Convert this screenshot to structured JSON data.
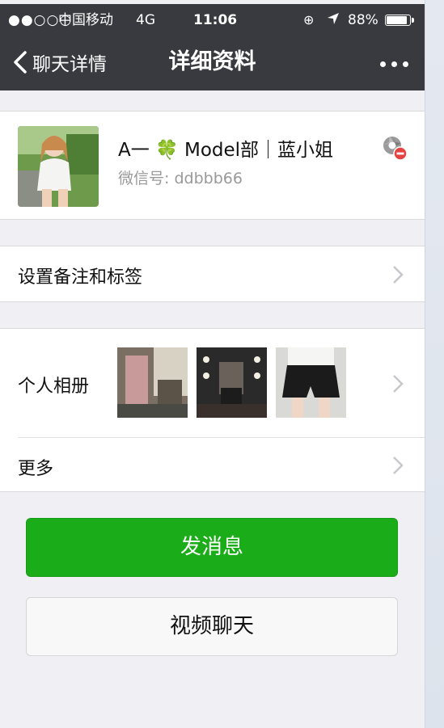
{
  "status_bar": {
    "signal": "●●○○○",
    "carrier": "中国移动",
    "network": "4G",
    "time": "11:06",
    "lock_icon": "⊕",
    "location_icon": "➤",
    "battery": "88%",
    "battery_level": 0.88
  },
  "nav": {
    "back_label": "聊天详情",
    "title": "详细资料",
    "more_icon": "more-dots-icon"
  },
  "profile": {
    "nickname": "A一 🍀 Model部｜蓝小姐",
    "wechat_id_label": "微信号:",
    "wechat_id": "ddbbb66",
    "star_icon": "star-friend-icon"
  },
  "rows": {
    "remark_label": "设置备注和标签",
    "album_label": "个人相册",
    "more_label": "更多"
  },
  "buttons": {
    "send_message": "发消息",
    "video_chat": "视频聊天"
  },
  "colors": {
    "nav_bg": "#393a3f",
    "page_bg": "#efeff4",
    "primary_green": "#1aad19",
    "badge_red": "#e64340"
  }
}
